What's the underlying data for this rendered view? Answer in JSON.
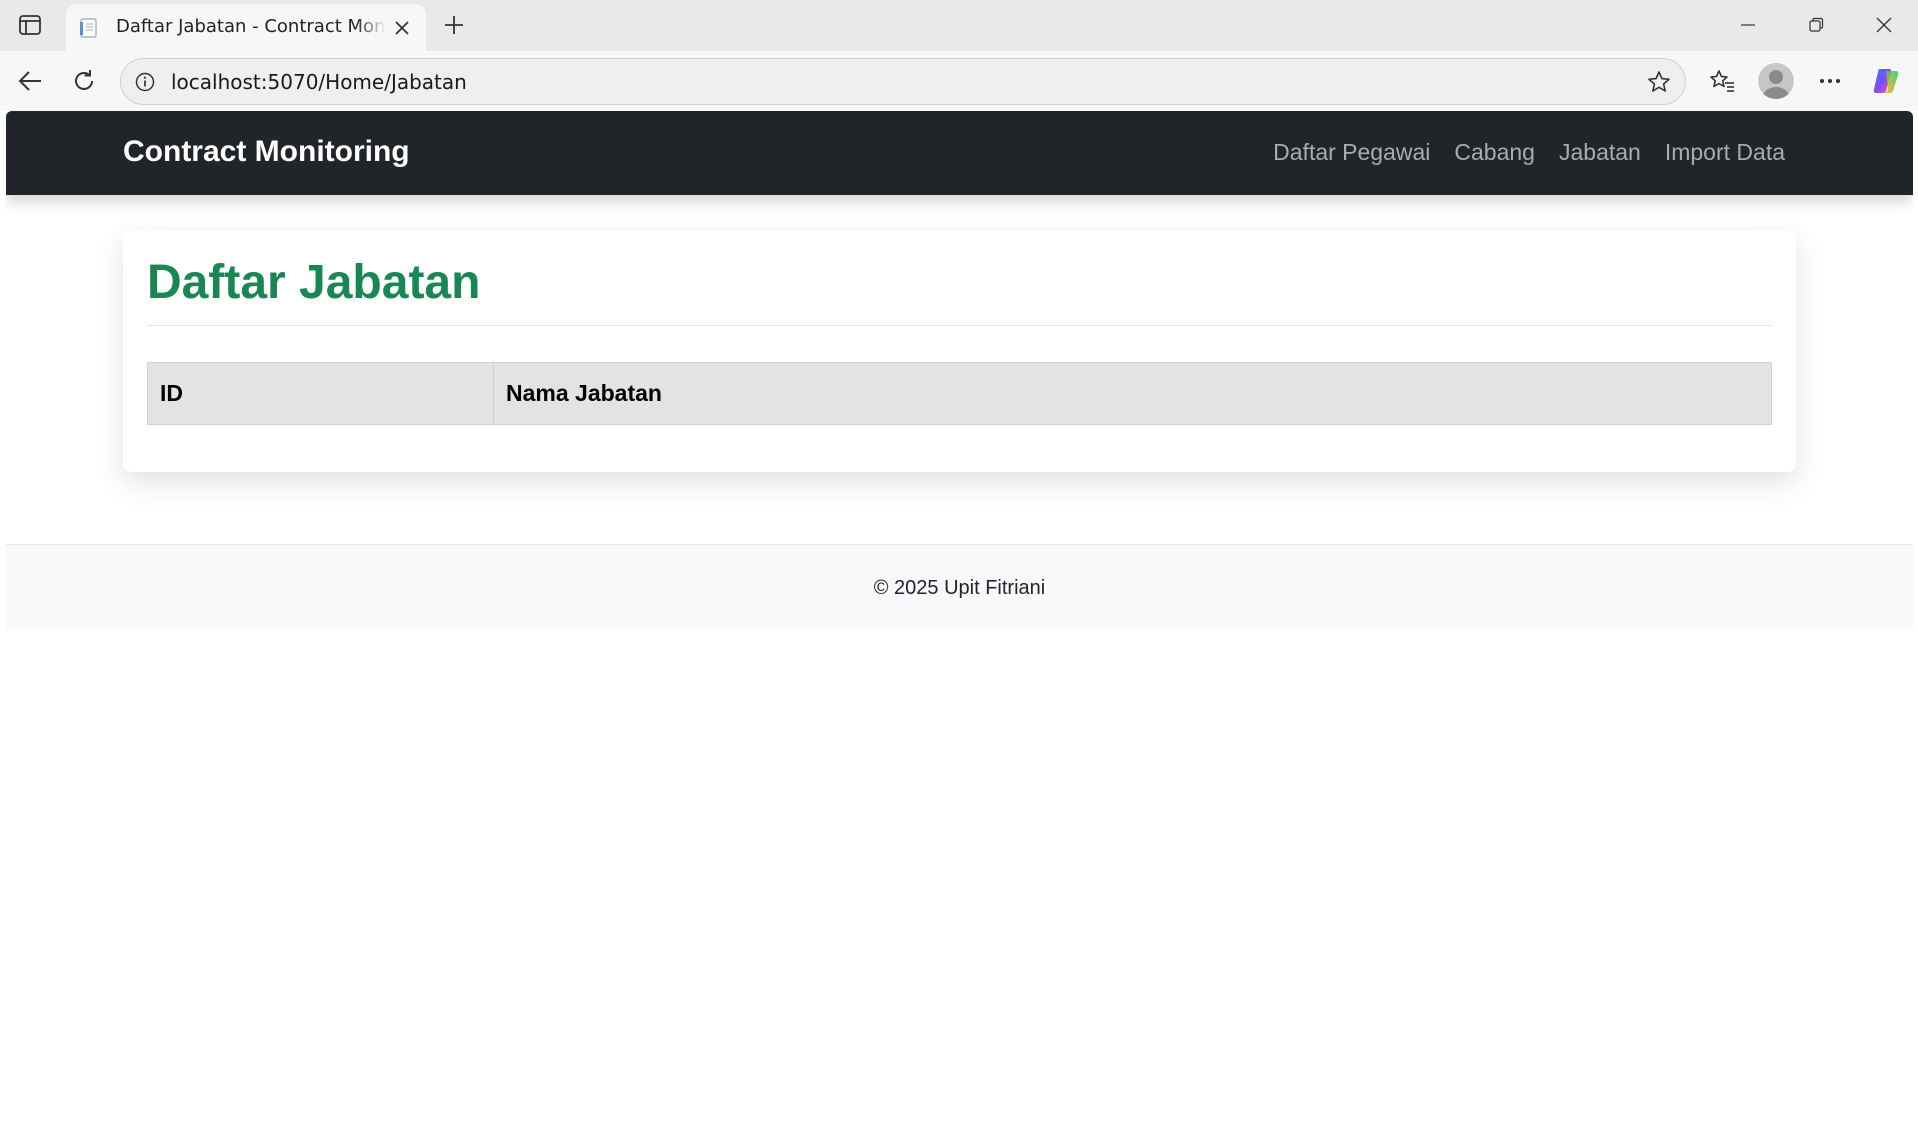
{
  "browser": {
    "tab_title": "Daftar Jabatan - Contract Monitoring",
    "url": "localhost:5070/Home/Jabatan"
  },
  "navbar": {
    "brand": "Contract Monitoring",
    "links": [
      "Daftar Pegawai",
      "Cabang",
      "Jabatan",
      "Import Data"
    ],
    "background": "#212529",
    "link_color": "#a9acaf"
  },
  "main": {
    "title": "Daftar Jabatan",
    "title_color": "#198754",
    "table": {
      "headers": [
        "ID",
        "Nama Jabatan"
      ],
      "rows": []
    }
  },
  "footer": {
    "text": "© 2025 Upit Fitriani"
  },
  "icons": [
    "sidebar-toggle-icon",
    "page-favicon-icon",
    "close-icon",
    "plus-icon",
    "minimize-icon",
    "restore-icon",
    "back-arrow-icon",
    "refresh-icon",
    "info-icon",
    "star-icon",
    "favorites-icon",
    "profile-avatar-icon",
    "more-icon",
    "copilot-icon"
  ]
}
